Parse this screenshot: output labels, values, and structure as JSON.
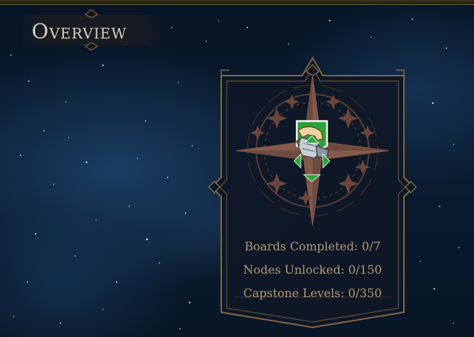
{
  "header": {
    "title": "Overview"
  },
  "card": {
    "emblem_icon": "compass-star-emblem",
    "class_icon": "gauntlet-icon",
    "stats": [
      {
        "label": "Boards Completed:",
        "value": "0/7"
      },
      {
        "label": "Nodes Unlocked:",
        "value": "0/150"
      },
      {
        "label": "Capstone Levels:",
        "value": "0/350"
      }
    ],
    "stat_lines": [
      "Boards Completed: 0/7",
      "Nodes Unlocked: 0/150",
      "Capstone Levels: 0/350"
    ]
  },
  "colors": {
    "gold": "#b39a78",
    "frame": "#8a6a45",
    "panel": "#111a29",
    "accent_green": "#2aa43a",
    "title_text": "#d8d0bd"
  }
}
